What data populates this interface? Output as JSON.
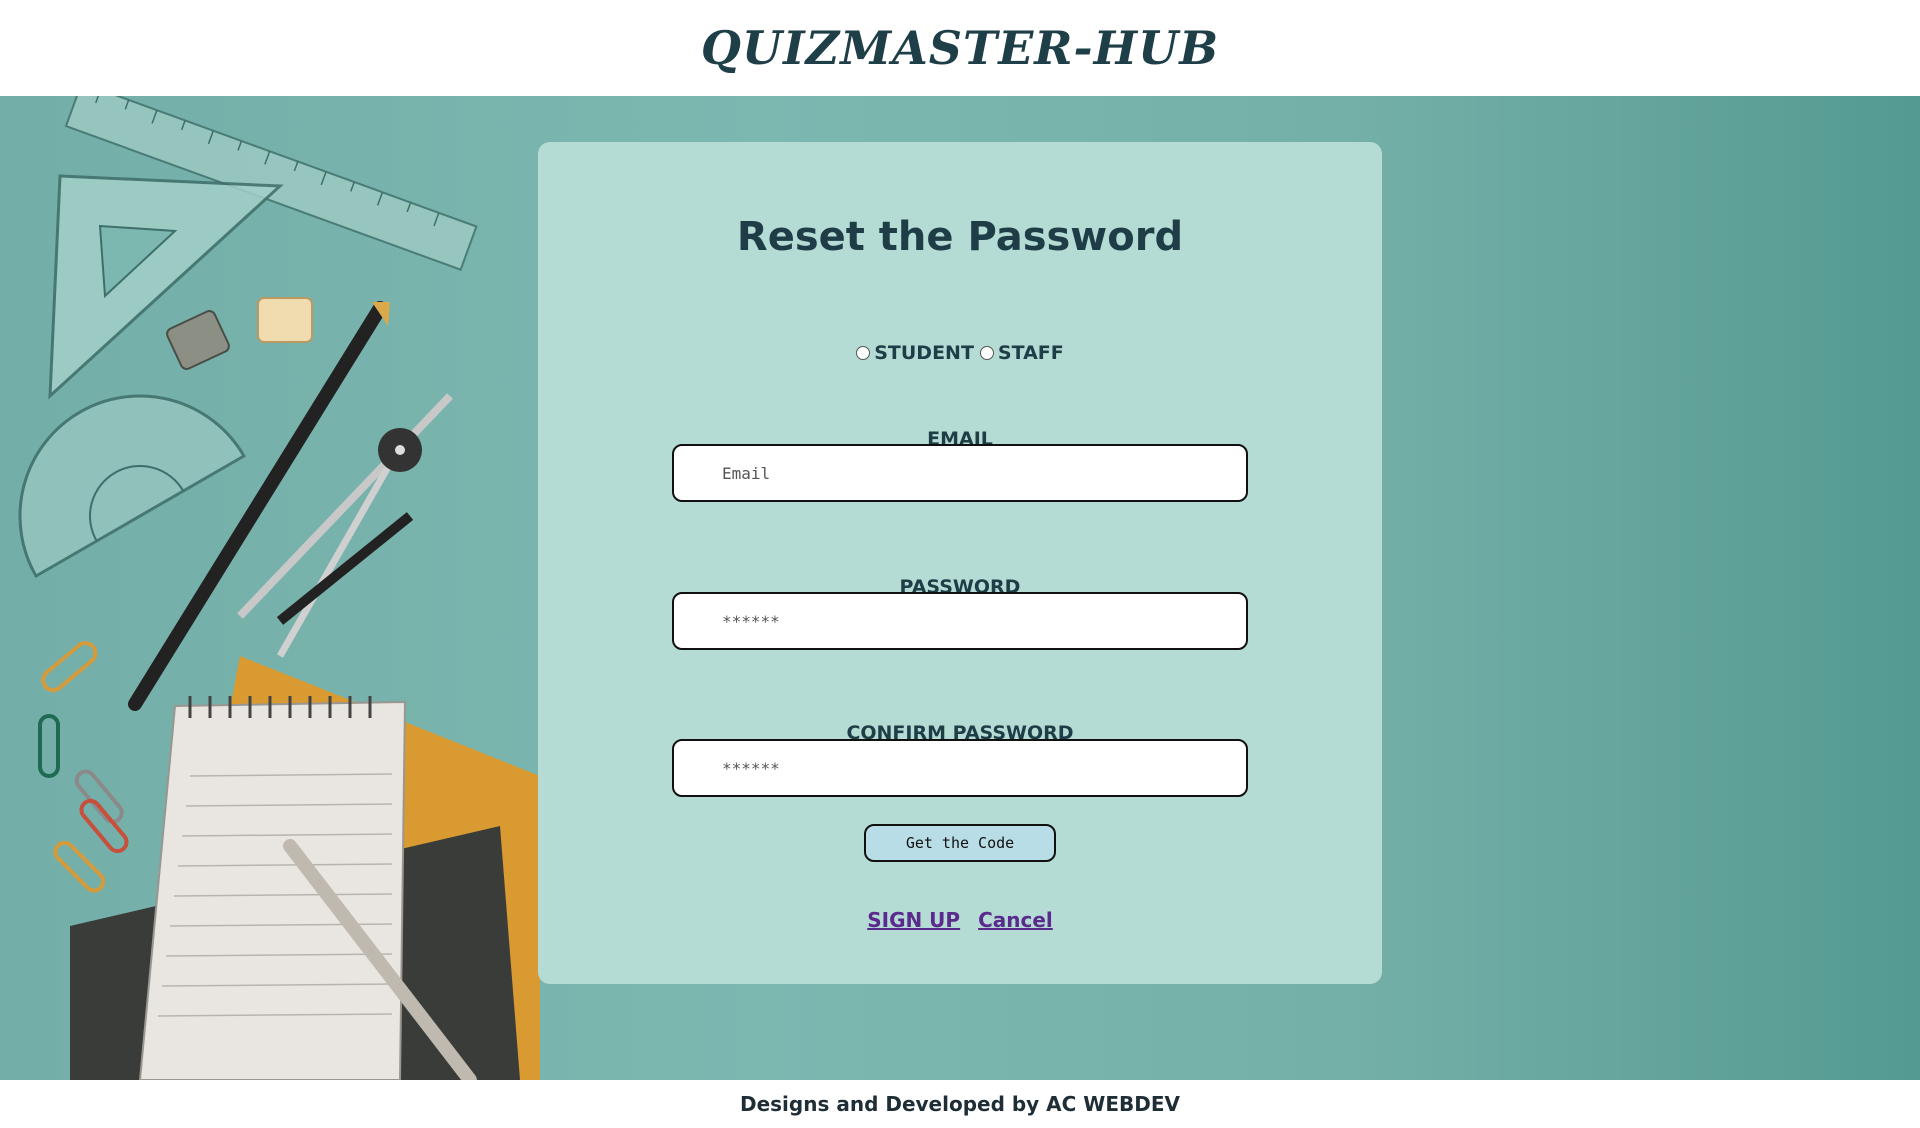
{
  "header": {
    "brand": "QUIZMASTER-HUB"
  },
  "form": {
    "title": "Reset the Password",
    "roles": [
      {
        "label": "STUDENT",
        "selected": false
      },
      {
        "label": "STAFF",
        "selected": false
      }
    ],
    "email": {
      "label": "EMAIL",
      "placeholder": "Email",
      "value": ""
    },
    "password": {
      "label": "PASSWORD",
      "placeholder": "******",
      "value": ""
    },
    "confirm_password": {
      "label": "CONFIRM PASSWORD",
      "placeholder": "******",
      "value": ""
    },
    "get_code_label": "Get the Code",
    "links": {
      "signup": "SIGN UP",
      "cancel": "Cancel"
    }
  },
  "footer": {
    "text": "Designs and Developed by AC WEBDEV"
  },
  "colors": {
    "card_bg": "#b4dbd4",
    "title_text": "#1e3d46",
    "link": "#5a2a8c",
    "button_bg": "#b8dde6",
    "hero_bg": "#74aea8"
  }
}
